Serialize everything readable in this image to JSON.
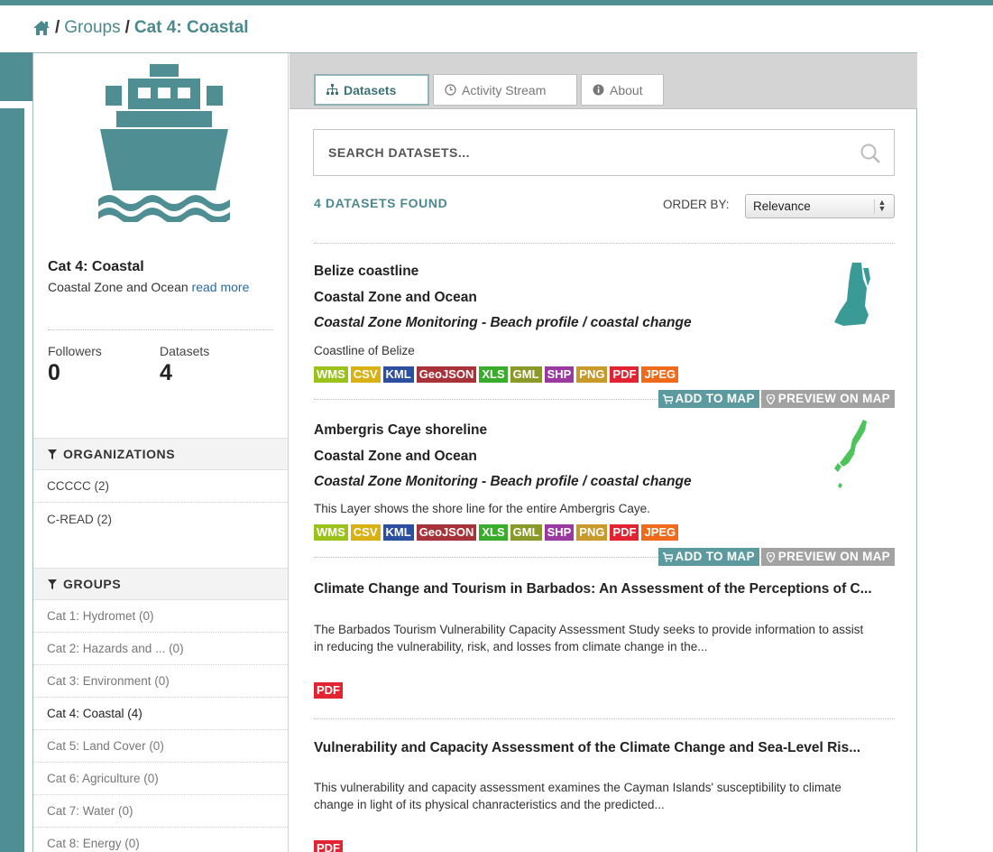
{
  "breadcrumb": {
    "groups": "Groups",
    "current": "Cat 4: Coastal",
    "sep": "/"
  },
  "group": {
    "title": "Cat 4: Coastal",
    "description": "Coastal Zone and Ocean",
    "read_more": "read more",
    "followers_label": "Followers",
    "followers_value": "0",
    "datasets_label": "Datasets",
    "datasets_value": "4"
  },
  "facets": {
    "organizations": {
      "title": "ORGANIZATIONS",
      "items": [
        {
          "label": "CCCCC (2)"
        },
        {
          "label": "C-READ (2)"
        }
      ]
    },
    "groups": {
      "title": "GROUPS",
      "items": [
        {
          "label": "Cat 1: Hydromet (0)"
        },
        {
          "label": "Cat 2: Hazards and ... (0)"
        },
        {
          "label": "Cat 3: Environment (0)"
        },
        {
          "label": "Cat 4: Coastal (4)"
        },
        {
          "label": "Cat 5: Land Cover (0)"
        },
        {
          "label": "Cat 6: Agriculture (0)"
        },
        {
          "label": "Cat 7: Water (0)"
        },
        {
          "label": "Cat 8: Energy (0)"
        }
      ]
    }
  },
  "tabs": [
    {
      "label": "Datasets",
      "icon": "sitemap-icon",
      "active": true
    },
    {
      "label": "Activity Stream",
      "icon": "clock-icon",
      "active": false
    },
    {
      "label": "About",
      "icon": "info-icon",
      "active": false
    }
  ],
  "search": {
    "placeholder": "SEARCH DATASETS..."
  },
  "results": {
    "found": "4 DATASETS FOUND",
    "order_by_label": "ORDER BY:",
    "order_by_value": "Relevance"
  },
  "actions": {
    "add_to_map": "ADD TO MAP",
    "preview_on_map": "PREVIEW ON MAP"
  },
  "datasets": [
    {
      "title": "Belize coastline",
      "org": "Coastal Zone and Ocean",
      "subtitle": "Coastal Zone Monitoring - Beach profile / coastal change",
      "notes": "Coastline of Belize",
      "formats": [
        "WMS",
        "CSV",
        "KML",
        "GeoJSON",
        "XLS",
        "GML",
        "SHP",
        "PNG",
        "PDF",
        "JPEG"
      ]
    },
    {
      "title": "Ambergris Caye shoreline",
      "org": "Coastal Zone and Ocean",
      "subtitle": "Coastal Zone Monitoring - Beach profile / coastal change",
      "notes": "This Layer shows the shore line for the entire Ambergris Caye.",
      "formats": [
        "WMS",
        "CSV",
        "KML",
        "GeoJSON",
        "XLS",
        "GML",
        "SHP",
        "PNG",
        "PDF",
        "JPEG"
      ]
    },
    {
      "title": "Climate Change and Tourism in Barbados: An Assessment of the Perceptions of C...",
      "notes": "The Barbados Tourism Vulnerability Capacity Assessment Study seeks to provide information to assist in reducing the vulnerability, risk, and losses from climate change in the...",
      "formats": [
        "PDF"
      ]
    },
    {
      "title": "Vulnerability and Capacity Assessment of the Climate Change and Sea-Level Ris...",
      "notes": "This vulnerability and capacity assessment examines the Cayman Islands' susceptibility to climate change in light of its physical chanracteristics and the predicted...",
      "formats": [
        "PDF"
      ]
    }
  ],
  "colors": {
    "accent": "#4a8a8f",
    "ship": "#4f8f94",
    "add_button": "#5c9aa0",
    "preview_button": "#a2a2a2"
  }
}
